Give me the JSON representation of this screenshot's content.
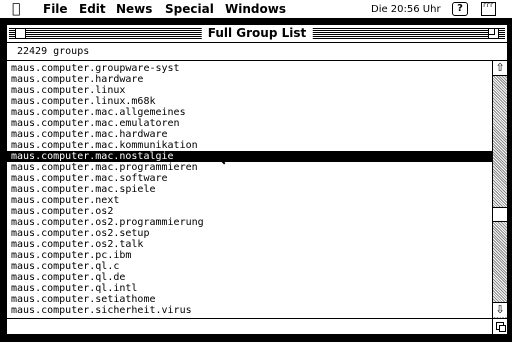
{
  "menubar": {
    "apple": "",
    "items": [
      "File",
      "Edit",
      "News",
      "Special",
      "Windows"
    ],
    "clock": "Die 20:56 Uhr",
    "help": "?",
    "app_icon": "ᴦᴦᴦ"
  },
  "window": {
    "title": "Full Group List",
    "group_count": "22429 groups",
    "groups": [
      "maus.computer.groupware-syst",
      "maus.computer.hardware",
      "maus.computer.linux",
      "maus.computer.linux.m68k",
      "maus.computer.mac.allgemeines",
      "maus.computer.mac.emulatoren",
      "maus.computer.mac.hardware",
      "maus.computer.mac.kommunikation",
      "maus.computer.mac.nostalgie",
      "maus.computer.mac.programmieren",
      "maus.computer.mac.software",
      "maus.computer.mac.spiele",
      "maus.computer.next",
      "maus.computer.os2",
      "maus.computer.os2.programmierung",
      "maus.computer.os2.setup",
      "maus.computer.os2.talk",
      "maus.computer.pc.ibm",
      "maus.computer.ql.c",
      "maus.computer.ql.de",
      "maus.computer.ql.intl",
      "maus.computer.setiathome",
      "maus.computer.sicherheit.virus"
    ],
    "selected_index": 8
  },
  "scrollbar": {
    "up": "⇧",
    "down": "⇩",
    "position": 0.62
  }
}
